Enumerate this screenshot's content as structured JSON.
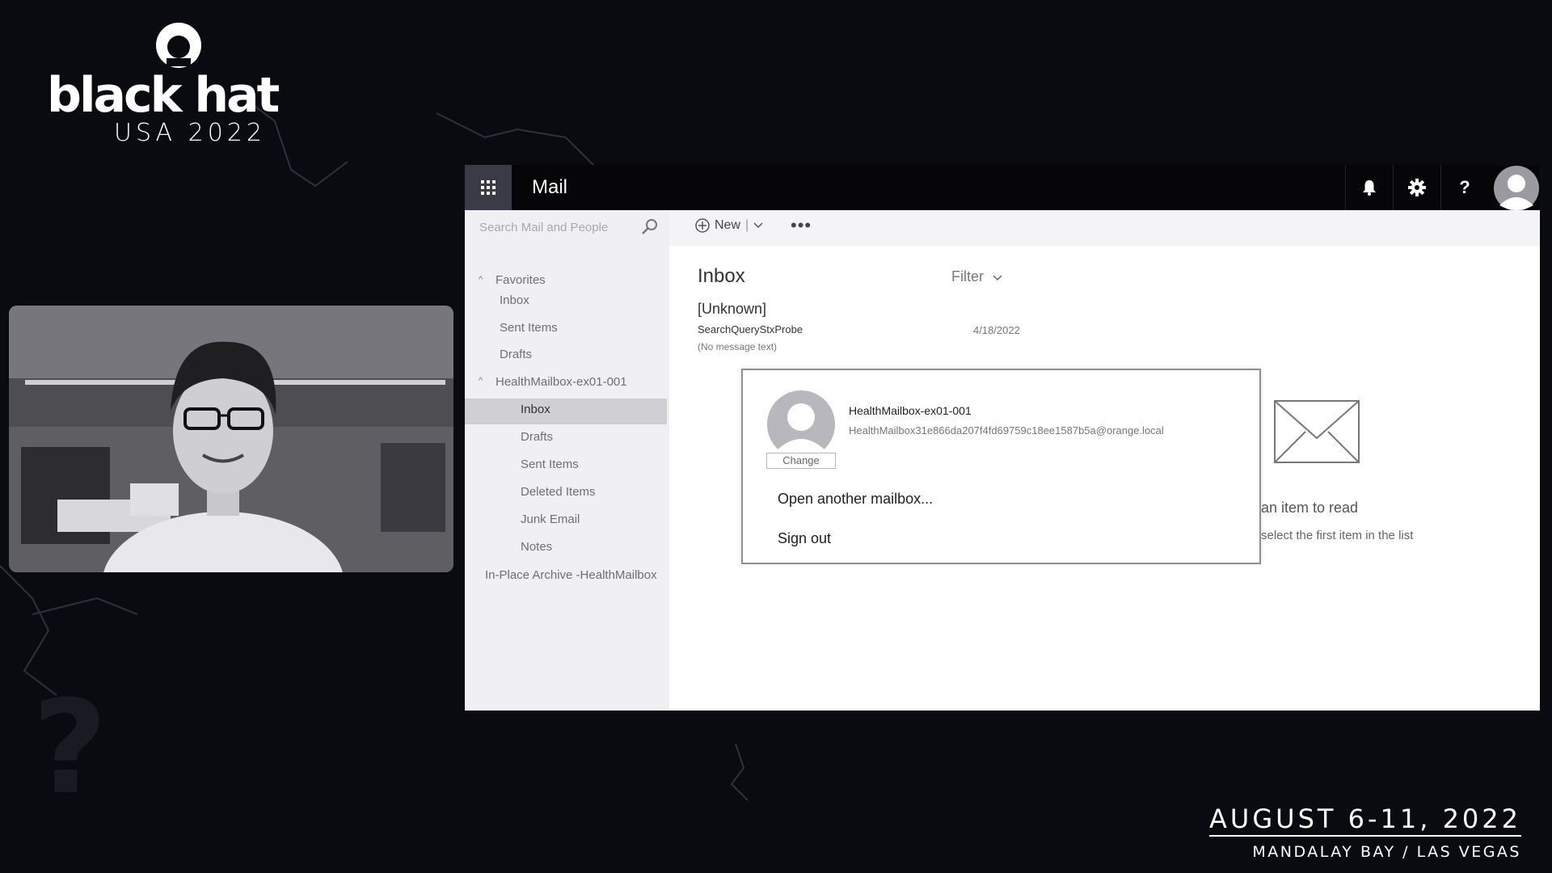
{
  "branding": {
    "wordmark": "black hat",
    "edition": "USA 2022",
    "dates": "AUGUST 6-11, 2022",
    "venue": "MANDALAY BAY / LAS VEGAS"
  },
  "header": {
    "app_title": "Mail",
    "icons": [
      "waffle-icon",
      "bell-icon",
      "gear-icon",
      "help-icon",
      "avatar"
    ],
    "help_label": "?"
  },
  "search": {
    "placeholder": "Search Mail and People"
  },
  "sidebar": {
    "favorites_label": "Favorites",
    "favorites": [
      "Inbox",
      "Sent Items",
      "Drafts"
    ],
    "mailbox_label": "HealthMailbox-ex01-001",
    "folders": [
      "Inbox",
      "Drafts",
      "Sent Items",
      "Deleted Items",
      "Junk Email",
      "Notes"
    ],
    "selected_folder": "Inbox",
    "archive_label": "In-Place Archive -HealthMailbox"
  },
  "toolbar": {
    "new_label": "New",
    "more_label": "•••"
  },
  "message_list": {
    "title": "Inbox",
    "filter_label": "Filter",
    "items": [
      {
        "sender": "[Unknown]",
        "subject": "SearchQueryStxProbe",
        "date": "4/18/2022",
        "preview": "(No message text)"
      }
    ]
  },
  "reading_pane": {
    "line1": "an item to read",
    "line2": "select the first item in the list"
  },
  "account_popup": {
    "name": "HealthMailbox-ex01-001",
    "email": "HealthMailbox31e866da207f4fd69759c18ee1587b5a@orange.local",
    "change_label": "Change",
    "open_another_label": "Open another mailbox...",
    "sign_out_label": "Sign out"
  },
  "colors": {
    "background": "#0a0b10",
    "topbar": "#060608",
    "waffle_tile": "#3b3b48",
    "selected_folder": "#cfcfd4"
  }
}
